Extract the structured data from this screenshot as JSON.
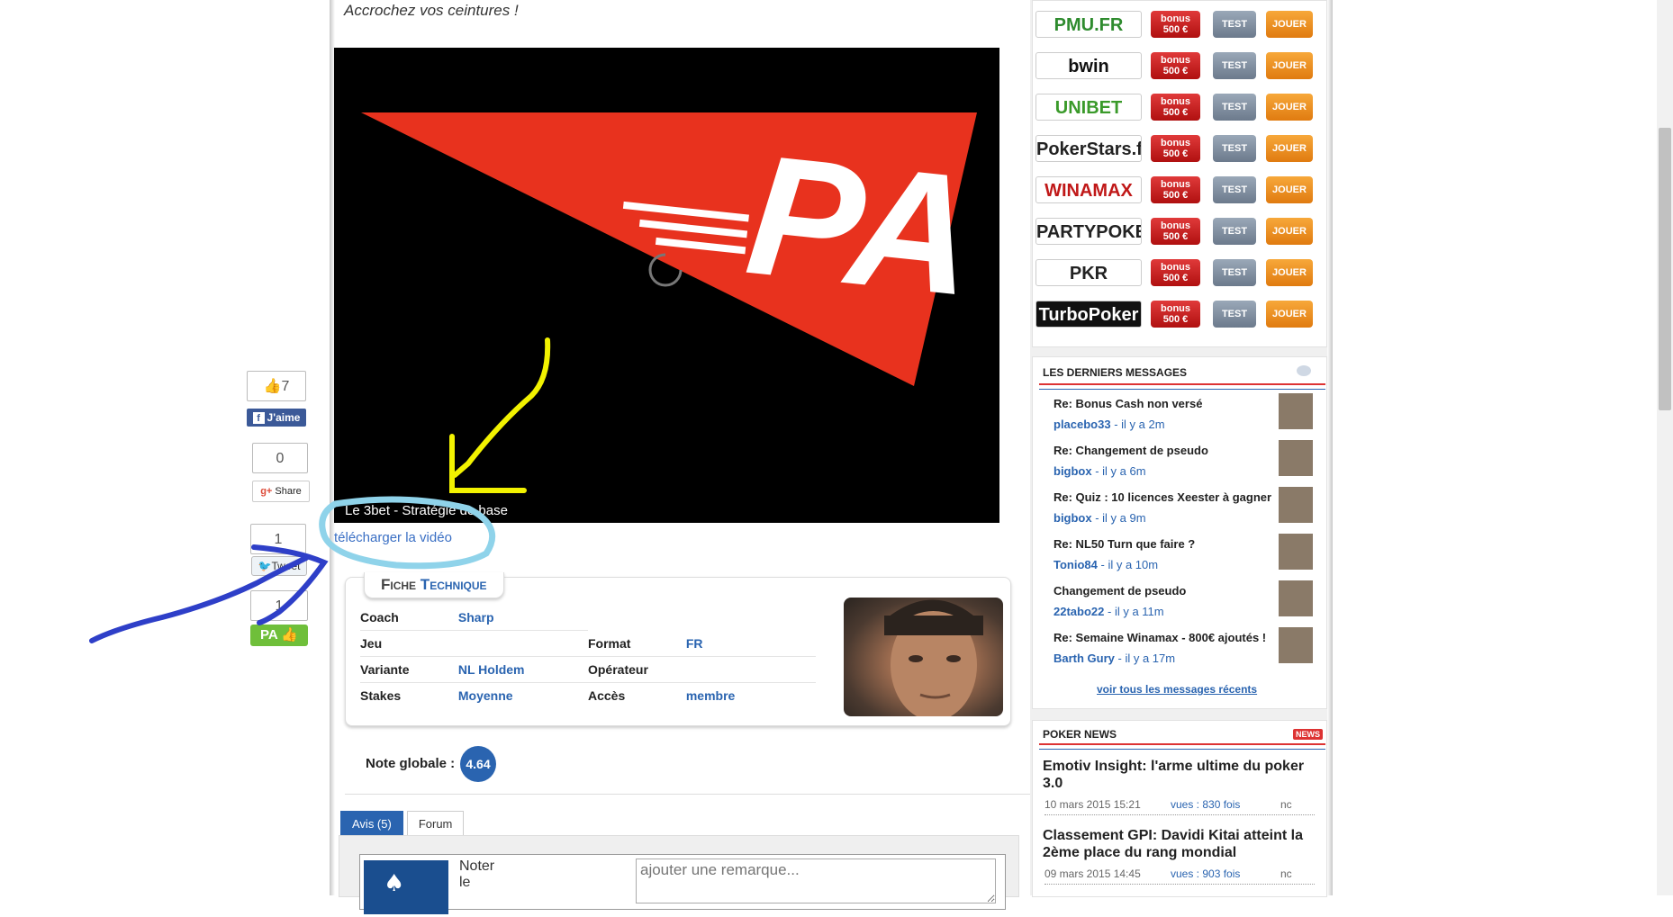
{
  "intro_text": "Accrochez vos ceintures !",
  "video": {
    "caption": "Le 3bet - Stratégie de base",
    "logo_text": "PA",
    "download_label": "télécharger la vidéo"
  },
  "share": {
    "like_count": "7",
    "fb_label": "J'aime",
    "gplus_count": "0",
    "gplus_label": "Share",
    "tweet_count": "1",
    "tweet_label": "Tweet",
    "pa_count": "1",
    "pa_label": "PA"
  },
  "fiche": {
    "title_first": "F",
    "title_rest": "iche ",
    "title_accent": "T",
    "title_end": "echnique",
    "rows": [
      {
        "k1": "Coach",
        "v1": "Sharp",
        "k2": "",
        "v2": ""
      },
      {
        "k1": "Jeu",
        "v1": "",
        "k2": "Format",
        "v2": "FR"
      },
      {
        "k1": "Variante",
        "v1": "NL Holdem",
        "k2": "Opérateur",
        "v2": ""
      },
      {
        "k1": "Stakes",
        "v1": "Moyenne",
        "k2": "Accès",
        "v2": "membre"
      }
    ]
  },
  "rating": {
    "label": "Note globale :",
    "value": "4.64"
  },
  "tabs": [
    {
      "label": "Avis (5)",
      "active": true
    },
    {
      "label": "Forum",
      "active": false
    }
  ],
  "review": {
    "label_line1": "Noter",
    "label_line2": "le",
    "placeholder": "ajouter une remarque..."
  },
  "operators": [
    {
      "name": "PMU.FR",
      "color": "#2e8b2e",
      "bonus_line1": "bonus",
      "bonus_line2": "500 €",
      "test": "TEST",
      "play": "JOUER"
    },
    {
      "name": "bwin",
      "color": "#111111",
      "bonus_line1": "bonus",
      "bonus_line2": "500 €",
      "test": "TEST",
      "play": "JOUER"
    },
    {
      "name": "UNIBET",
      "color": "#3a9a2a",
      "bonus_line1": "bonus",
      "bonus_line2": "500 €",
      "test": "TEST",
      "play": "JOUER"
    },
    {
      "name": "PokerStars.fr",
      "color": "#222222",
      "bonus_line1": "bonus",
      "bonus_line2": "500 €",
      "test": "TEST",
      "play": "JOUER"
    },
    {
      "name": "WINAMAX",
      "color": "#c01818",
      "bonus_line1": "bonus",
      "bonus_line2": "500 €",
      "test": "TEST",
      "play": "JOUER"
    },
    {
      "name": "PARTYPOKER.fr",
      "color": "#222222",
      "bonus_line1": "bonus",
      "bonus_line2": "500 €",
      "test": "TEST",
      "play": "JOUER"
    },
    {
      "name": "PKR",
      "color": "#222222",
      "bonus_line1": "bonus",
      "bonus_line2": "500 €",
      "test": "TEST",
      "play": "JOUER"
    },
    {
      "name": "TurboPoker",
      "color": "#ffffff",
      "bonus_line1": "bonus",
      "bonus_line2": "500 €",
      "test": "TEST",
      "play": "JOUER"
    }
  ],
  "messages": {
    "heading": "LES DERNIERS MESSAGES",
    "items": [
      {
        "title": "Re: Bonus Cash non versé",
        "author": "placebo33",
        "time": "il y a 2m"
      },
      {
        "title": "Re: Changement de pseudo",
        "author": "bigbox",
        "time": "il y a 6m"
      },
      {
        "title": "Re: Quiz : 10 licences Xeester à gagner",
        "author": "bigbox",
        "time": "il y a 9m"
      },
      {
        "title": "Re: NL50 Turn que faire ?",
        "author": "Tonio84",
        "time": "il y a 10m"
      },
      {
        "title": "Changement de pseudo",
        "author": "22tabo22",
        "time": "il y a 11m"
      },
      {
        "title": "Re: Semaine Winamax - 800€ ajoutés !",
        "author": "Barth Gury",
        "time": "il y a 17m"
      }
    ],
    "separator": " - ",
    "all_link": "voir tous les messages récents"
  },
  "news": {
    "heading": "POKER NEWS",
    "badge": "NEWS",
    "items": [
      {
        "title": "Emotiv Insight: l'arme ultime du poker 3.0",
        "date": "10 mars 2015 15:21",
        "views": "vues : 830 fois",
        "comments": "nc"
      },
      {
        "title": "Classement GPI: Davidi Kitai atteint la 2ème place du rang mondial",
        "date": "09 mars 2015 14:45",
        "views": "vues : 903 fois",
        "comments": "nc"
      }
    ]
  },
  "colors": {
    "accent_blue": "#2a64b0",
    "annotation_yellow": "#f2f200",
    "annotation_lightblue": "#8fd3ea",
    "annotation_darkblue": "#2e3fc8",
    "video_red": "#e8321e"
  }
}
